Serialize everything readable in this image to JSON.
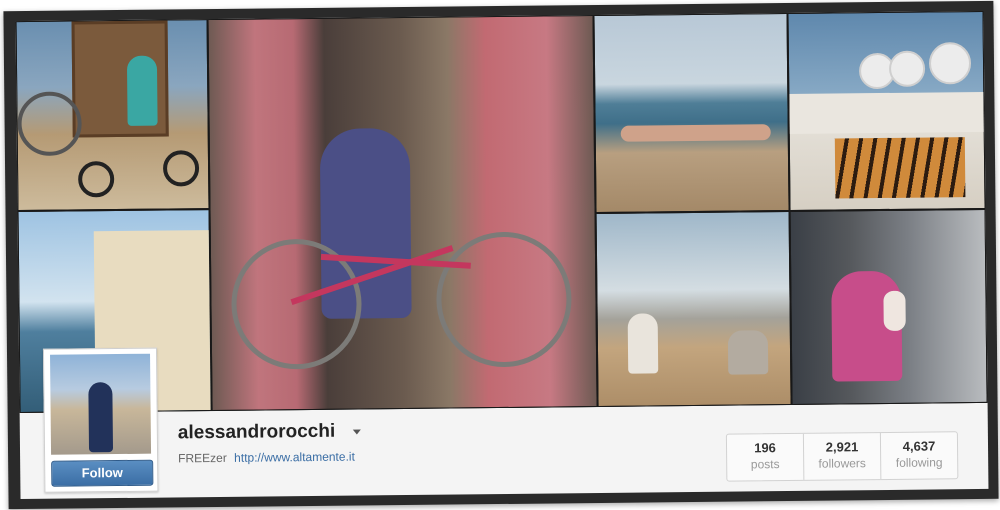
{
  "profile": {
    "username": "alessandrorocchi",
    "bio_name": "FREEzer",
    "bio_link": "http://www.altamente.it",
    "follow_label": "Follow"
  },
  "stats": [
    {
      "value": "196",
      "label": "posts"
    },
    {
      "value": "2,921",
      "label": "followers"
    },
    {
      "value": "4,637",
      "label": "following"
    }
  ],
  "icons": {
    "dropdown": "chevron-down-icon"
  },
  "colors": {
    "follow_button": "#3b6ea5",
    "link": "#3b6ea5"
  }
}
